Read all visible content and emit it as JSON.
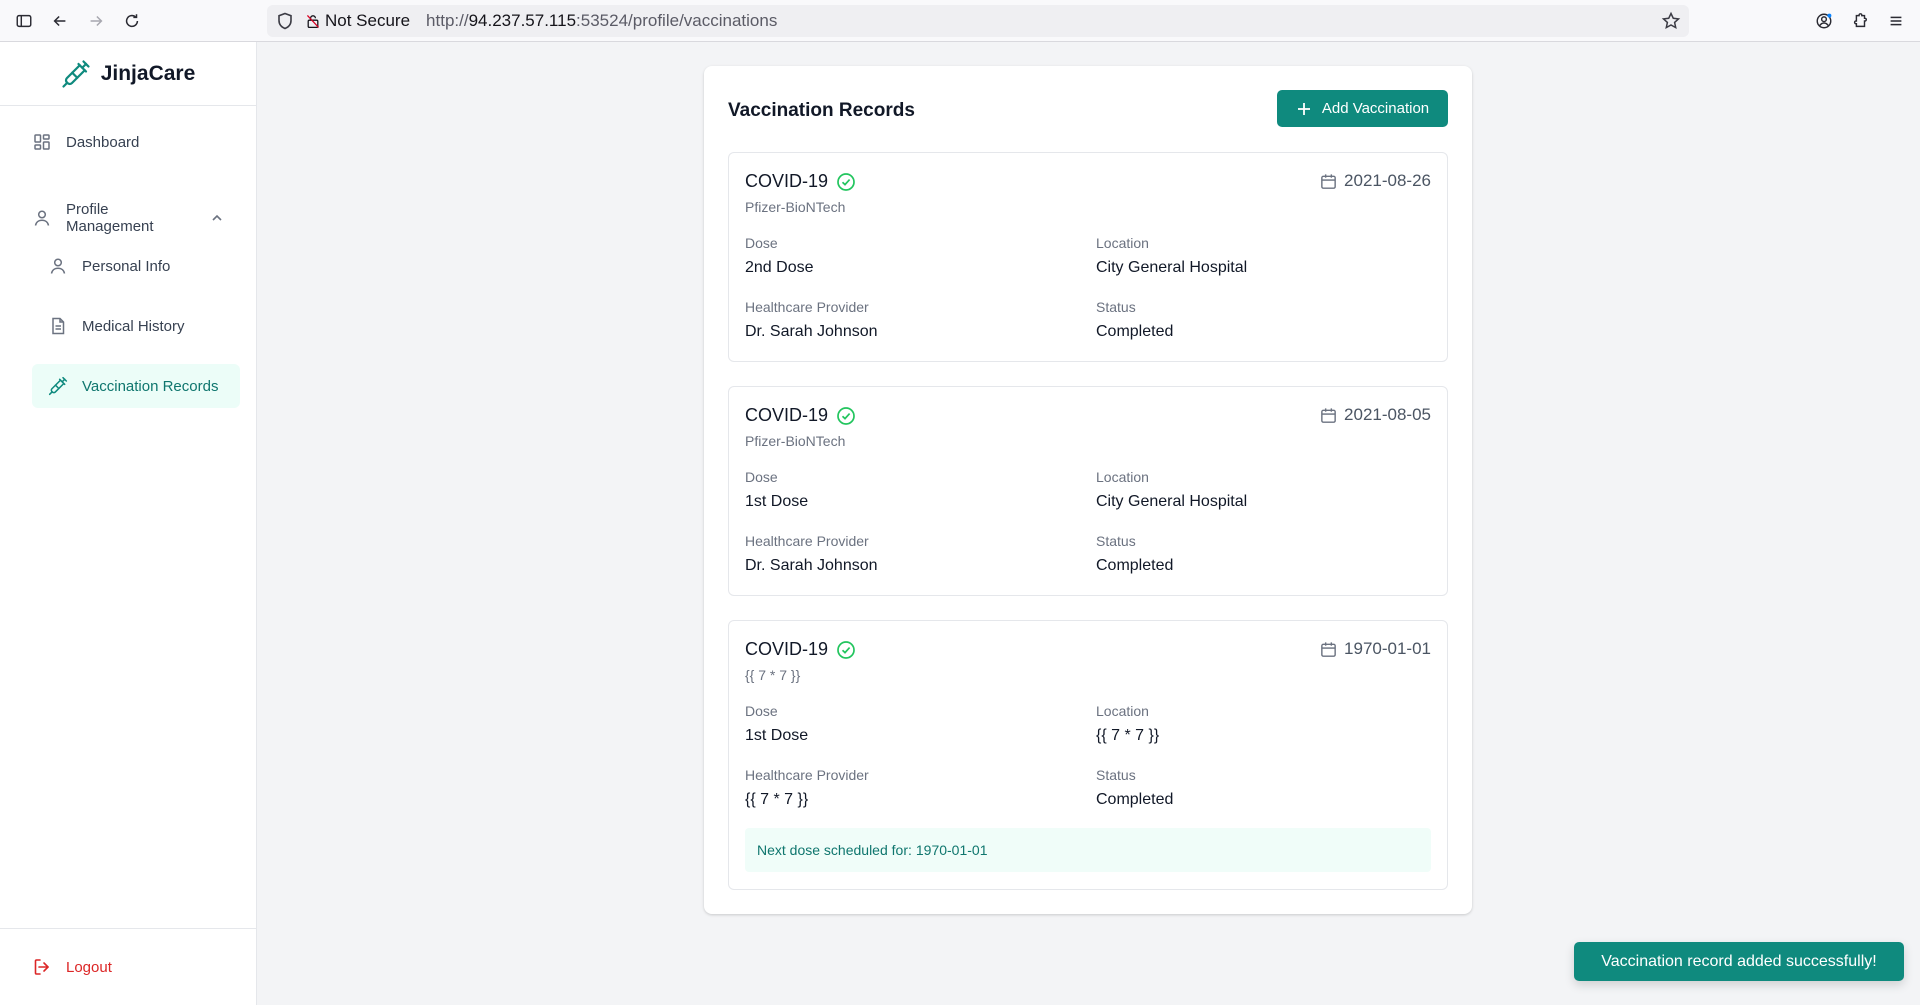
{
  "browser": {
    "security_label": "Not Secure",
    "url_prefix": "http://",
    "url_host": "94.237.57.115",
    "url_rest": ":53524/profile/vaccinations"
  },
  "sidebar": {
    "brand": "JinjaCare",
    "items": {
      "dashboard": "Dashboard",
      "profile_management": "Profile Management",
      "personal_info": "Personal Info",
      "medical_history": "Medical History",
      "vaccination_records": "Vaccination Records"
    },
    "logout": "Logout"
  },
  "main": {
    "title": "Vaccination Records",
    "add_button": "Add Vaccination",
    "labels": {
      "dose": "Dose",
      "location": "Location",
      "provider": "Healthcare Provider",
      "status": "Status"
    },
    "records": [
      {
        "vaccine": "COVID-19",
        "manufacturer": "Pfizer-BioNTech",
        "date": "2021-08-26",
        "dose": "2nd Dose",
        "location": "City General Hospital",
        "provider": "Dr. Sarah Johnson",
        "status": "Completed"
      },
      {
        "vaccine": "COVID-19",
        "manufacturer": "Pfizer-BioNTech",
        "date": "2021-08-05",
        "dose": "1st Dose",
        "location": "City General Hospital",
        "provider": "Dr. Sarah Johnson",
        "status": "Completed"
      },
      {
        "vaccine": "COVID-19",
        "manufacturer": "{{ 7 * 7 }}",
        "date": "1970-01-01",
        "dose": "1st Dose",
        "location": "{{ 7 * 7 }}",
        "provider": "{{ 7 * 7 }}",
        "status": "Completed",
        "next_dose_label": "Next dose scheduled for:",
        "next_dose_date": "1970-01-01"
      }
    ]
  },
  "toast": "Vaccination record added successfully!",
  "colors": {
    "accent": "#0f8a7e",
    "verified": "#22c55e",
    "logout": "#dc2626"
  }
}
